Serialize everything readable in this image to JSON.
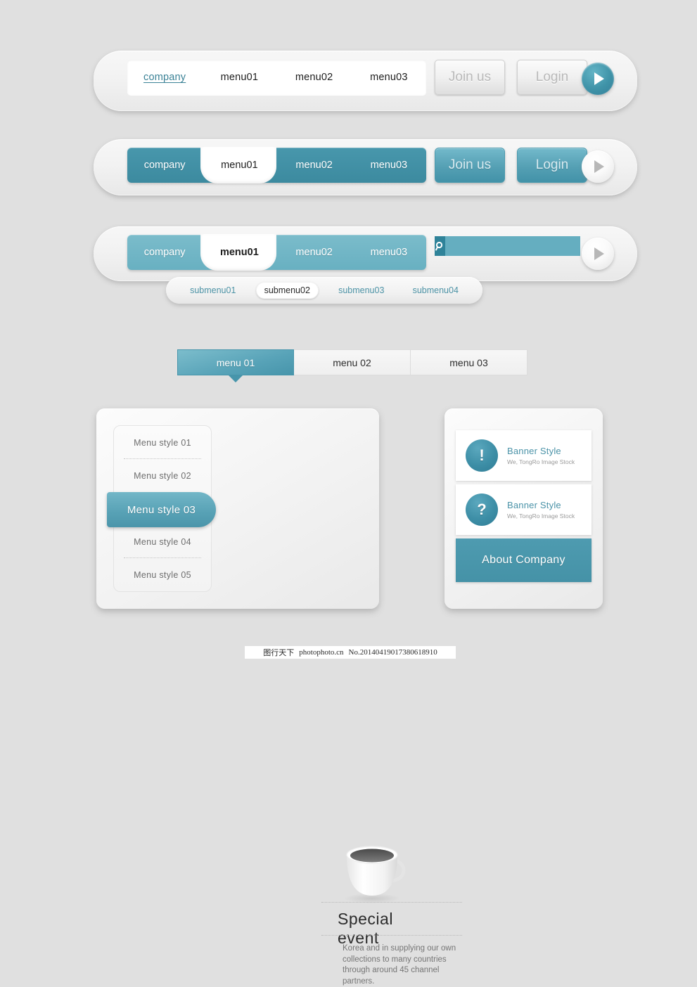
{
  "background_color": "#e0e0e0",
  "accent_teal": "#3f93a8",
  "accent_teal_light": "#68b0c1",
  "bar1": {
    "menu_items": [
      {
        "label": "company",
        "active": true
      },
      {
        "label": "menu01",
        "active": false
      },
      {
        "label": "menu02",
        "active": false
      },
      {
        "label": "menu03",
        "active": false
      }
    ],
    "join_label": "Join us",
    "login_label": "Login",
    "play_icon": "play-triangle-icon"
  },
  "bar2": {
    "menu_items": [
      {
        "label": "company",
        "active": false
      },
      {
        "label": "menu01",
        "active": true
      },
      {
        "label": "menu02",
        "active": false
      },
      {
        "label": "menu03",
        "active": false
      }
    ],
    "join_label": "Join us",
    "login_label": "Login",
    "play_icon": "play-triangle-icon"
  },
  "bar3": {
    "menu_items": [
      {
        "label": "company",
        "active": false
      },
      {
        "label": "menu01",
        "active": true
      },
      {
        "label": "menu02",
        "active": false
      },
      {
        "label": "menu03",
        "active": false
      }
    ],
    "search": {
      "icon": "search-magnifier-icon",
      "value": "",
      "placeholder": ""
    },
    "play_icon": "play-triangle-icon"
  },
  "submenu": {
    "items": [
      {
        "label": "submenu01",
        "active": false
      },
      {
        "label": "submenu02",
        "active": true
      },
      {
        "label": "submenu03",
        "active": false
      },
      {
        "label": "submenu04",
        "active": false
      }
    ]
  },
  "tabs": [
    {
      "label": "menu 01",
      "active": true
    },
    {
      "label": "menu 02",
      "active": false
    },
    {
      "label": "menu 03",
      "active": false
    }
  ],
  "left_panel": {
    "menu_styles": [
      {
        "label": "Menu style 01",
        "active": false
      },
      {
        "label": "Menu style 02",
        "active": false
      },
      {
        "label": "Menu style 03",
        "active": true
      },
      {
        "label": "Menu style 04",
        "active": false
      },
      {
        "label": "Menu style 05",
        "active": false
      }
    ],
    "image": "coffee-cup-image",
    "title": "Special event",
    "body": "Korea and in supplying our own collections to many countries through around 45 channel partners."
  },
  "right_panel": {
    "banners": [
      {
        "icon": "exclamation-icon",
        "glyph": "!",
        "title": "Banner Style",
        "subtitle": "We, TongRo Image Stock"
      },
      {
        "icon": "question-icon",
        "glyph": "?",
        "title": "Banner Style",
        "subtitle": "We, TongRo Image Stock"
      }
    ],
    "about_label": "About Company"
  },
  "footer": {
    "site_cn": "图行天下",
    "site_url": "photophoto.cn",
    "id": "No.20140419017380618910"
  }
}
